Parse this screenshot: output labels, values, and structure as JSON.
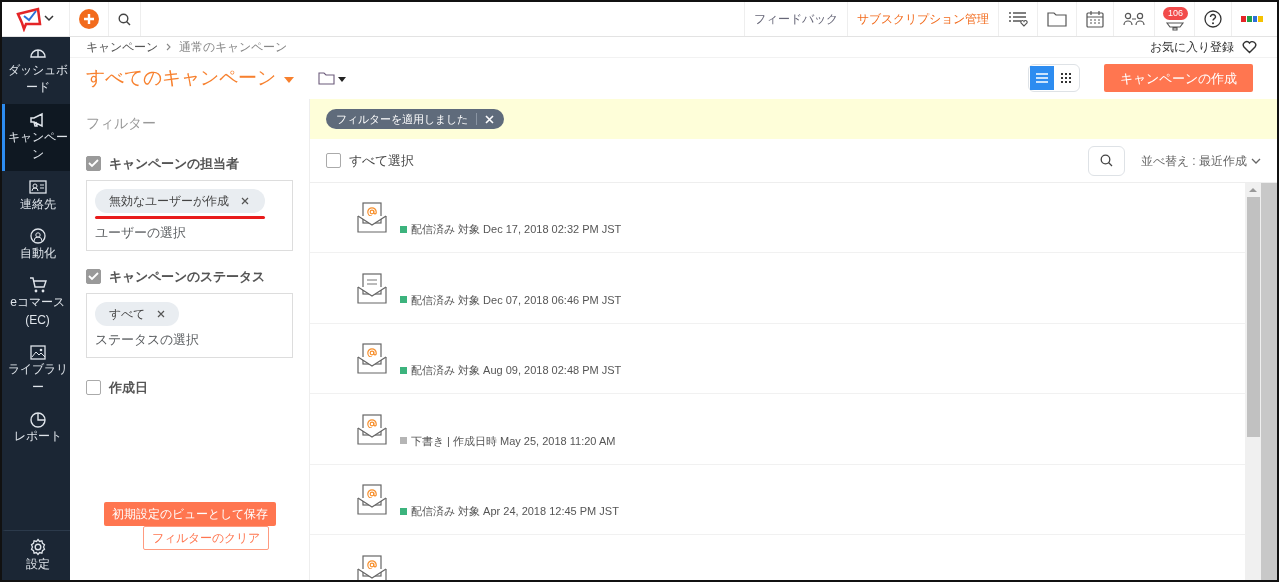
{
  "topbar": {
    "feedback": "フィードバック",
    "subscription": "サブスクリプション管理",
    "notification_count": "106"
  },
  "sidebar": {
    "items": [
      {
        "kind": "dashboard",
        "label": "ダッシュボード",
        "selected": false
      },
      {
        "kind": "campaign",
        "label": "キャンペーン",
        "selected": true
      },
      {
        "kind": "contacts",
        "label": "連絡先",
        "selected": false
      },
      {
        "kind": "automation",
        "label": "自動化",
        "selected": false
      },
      {
        "kind": "ecommerce",
        "label": "eコマース (EC)",
        "selected": false
      },
      {
        "kind": "library",
        "label": "ライブラリー",
        "selected": false
      },
      {
        "kind": "reports",
        "label": "レポート",
        "selected": false
      }
    ],
    "settings": "設定"
  },
  "breadcrumb": [
    "キャンペーン",
    "通常のキャンペーン"
  ],
  "favorite": "お気に入り登録",
  "title": "すべてのキャンペーン",
  "view_toggle": [
    {
      "kind": "list",
      "selected": true
    },
    {
      "kind": "grid",
      "selected": false
    }
  ],
  "create_button": "キャンペーンの作成",
  "filter": {
    "title": "フィルター",
    "groups": [
      {
        "label": "キャンペーンの担当者",
        "checked": true,
        "chips": [
          {
            "label": "無効なユーザーが作成",
            "underlined": true
          }
        ],
        "placeholder": "ユーザーの選択"
      },
      {
        "label": "キャンペーンのステータス",
        "checked": true,
        "chips": [
          {
            "label": "すべて",
            "underlined": false
          }
        ],
        "placeholder": "ステータスの選択"
      },
      {
        "label": "作成日",
        "checked": false
      }
    ],
    "save_button": "初期設定のビューとして保存",
    "clear_button": "フィルターのクリア"
  },
  "banner": "フィルターを適用しました",
  "select_all": {
    "label": "すべて選択",
    "checked": false
  },
  "sort": "並べ替え : 最近作成",
  "campaigns": [
    {
      "kind": "mail",
      "color": "#3cb37d",
      "status": "配信済み 対象 Dec 17, 2018 02:32 PM JST"
    },
    {
      "kind": "newsletter",
      "color": "#3cb37d",
      "status": "配信済み 対象 Dec 07, 2018 06:46 PM JST"
    },
    {
      "kind": "mail",
      "color": "#3cb37d",
      "status": "配信済み 対象 Aug 09, 2018 02:48 PM JST"
    },
    {
      "kind": "mail",
      "color": "#b5b5b5",
      "status": "下書き | 作成日時 May 25, 2018 11:20 AM"
    },
    {
      "kind": "mail",
      "color": "#3cb37d",
      "status": "配信済み 対象 Apr 24, 2018 12:45 PM JST"
    },
    {
      "kind": "mail"
    }
  ]
}
